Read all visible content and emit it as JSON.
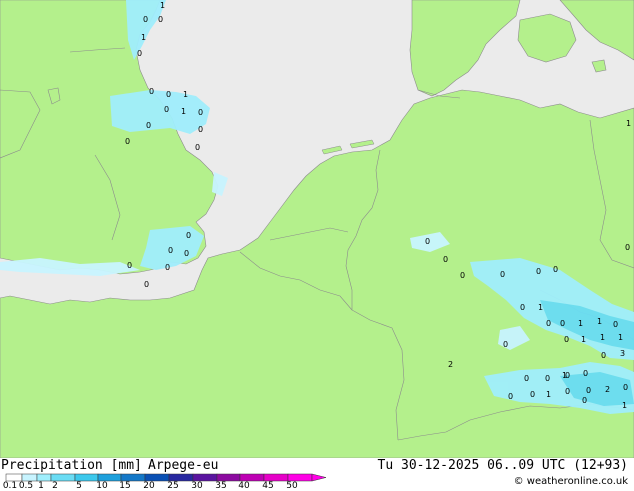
{
  "header": {
    "title": "Precipitation [mm]",
    "model": "Arpege-eu",
    "valid_time": "Tu 30-12-2025 06..09 UTC (12+93)"
  },
  "legend": {
    "ticks": [
      "0.1",
      "0.5",
      "1",
      "2",
      "5",
      "10",
      "15",
      "20",
      "25",
      "30",
      "35",
      "40",
      "45",
      "50"
    ],
    "colors": [
      "#ffffff",
      "#c8f4ff",
      "#a0eefc",
      "#6adcf4",
      "#3cc8ec",
      "#1ea0dc",
      "#1478c8",
      "#0a50b4",
      "#2828a0",
      "#5a14a0",
      "#8c0aa0",
      "#be00b4",
      "#e600c8",
      "#ff00e6"
    ]
  },
  "credit": "© weatheronline.co.uk",
  "colors": {
    "land": "#b4f08c",
    "sea": "#ebebeb",
    "border": "#8c8c8c",
    "precip_light": "#a0eefc",
    "precip_mid": "#6adcf4"
  },
  "values": [
    "1",
    "0",
    "0",
    "1",
    "0",
    "0",
    "1",
    "0",
    "1",
    "0",
    "0",
    "0",
    "0",
    "0",
    "0",
    "0",
    "0",
    "0",
    "0",
    "0",
    "0",
    "0",
    "0",
    "0",
    "1",
    "0",
    "0",
    "0",
    "0",
    "1",
    "0",
    "0",
    "0",
    "1",
    "1",
    "0",
    "0",
    "1",
    "1",
    "1",
    "0",
    "3",
    "0",
    "2",
    "0",
    "0",
    "0",
    "0",
    "2",
    "0",
    "1",
    "0",
    "0",
    "0",
    "0",
    "1",
    "1",
    "0"
  ]
}
